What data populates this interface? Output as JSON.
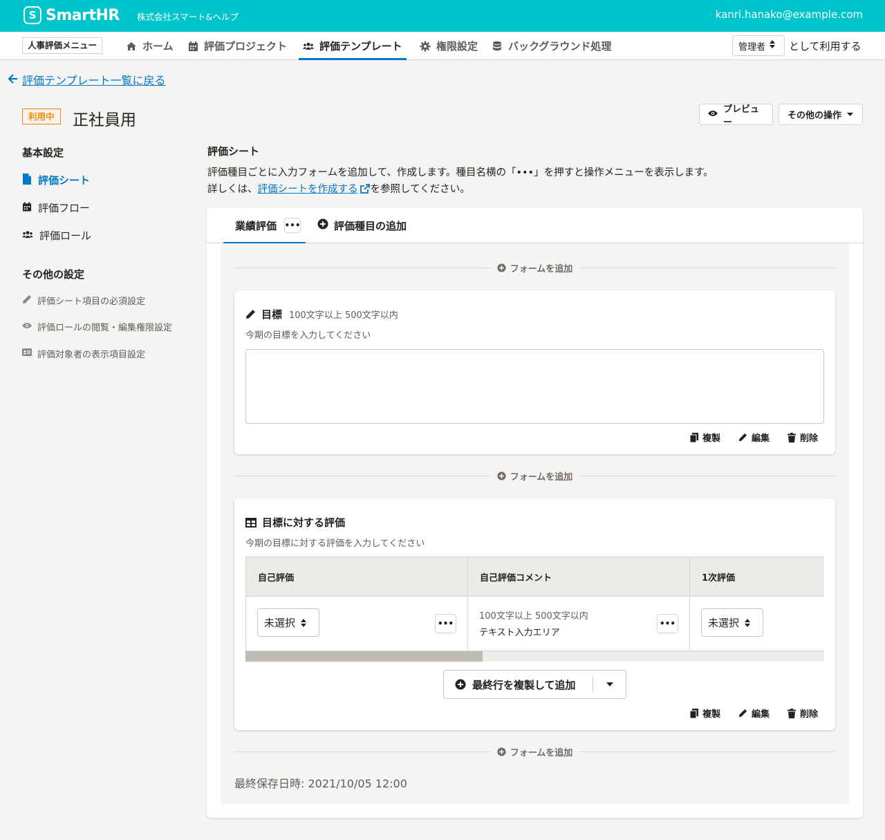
{
  "header": {
    "brand": "SmartHR",
    "tenant": "株式会社スマート&ヘルプ",
    "user_email": "kanri.hanako@example.com"
  },
  "nav": {
    "menu_label": "人事評価メニュー",
    "items": [
      {
        "label": "ホーム",
        "icon": "home-icon"
      },
      {
        "label": "評価プロジェクト",
        "icon": "calendar-icon"
      },
      {
        "label": "評価テンプレート",
        "icon": "users-icon",
        "active": true
      },
      {
        "label": "権限設定",
        "icon": "gear-icon"
      },
      {
        "label": "バックグラウンド処理",
        "icon": "database-icon"
      }
    ],
    "role_value": "管理者",
    "role_suffix": "として利用する"
  },
  "back_link": "評価テンプレート一覧に戻る",
  "template": {
    "status": "利用中",
    "title": "正社員用",
    "preview_label": "プレビュー",
    "other_actions_label": "その他の操作"
  },
  "sidebar": {
    "basic_heading": "基本設定",
    "basic_items": [
      {
        "label": "評価シート",
        "icon": "document-icon",
        "active": true
      },
      {
        "label": "評価フロー",
        "icon": "calendar-icon"
      },
      {
        "label": "評価ロール",
        "icon": "users-icon"
      }
    ],
    "other_heading": "その他の設定",
    "other_items": [
      {
        "label": "評価シート項目の必須設定",
        "icon": "pencil-icon"
      },
      {
        "label": "評価ロールの閲覧・編集権限設定",
        "icon": "eye-icon"
      },
      {
        "label": "評価対象者の表示項目設定",
        "icon": "id-card-icon"
      }
    ]
  },
  "sheet": {
    "heading": "評価シート",
    "description_line1": "評価種目ごとに入力フォームを追加して、作成します。種目名横の「•••」を押すと操作メニューを表示します。",
    "description_prefix": "詳しくは、",
    "description_link": "評価シートを作成する",
    "description_suffix": "を参照してください。",
    "tab_label": "業績評価",
    "tab_more": "•••",
    "add_category_label": "評価種目の追加",
    "add_form_label": "フォームを追加",
    "form1": {
      "title": "目標",
      "hint": "100文字以上  500文字以内",
      "description": "今期の目標を入力してください"
    },
    "form2": {
      "title": "目標に対する評価",
      "description": "今期の目標に対する評価を入力してください",
      "columns": [
        "自己評価",
        "自己評価コメント",
        "1次評価"
      ],
      "cell_select": "未選択",
      "cell_more": "•••",
      "comment_hint": "100文字以上  500文字以内",
      "comment_type": "テキスト入力エリア",
      "scroll_fraction": 0.41,
      "duplicate_add_label": "最終行を複製して追加"
    },
    "actions": {
      "duplicate": "複製",
      "edit": "編集",
      "delete": "削除"
    },
    "last_saved": "最終保存日時: 2021/10/05 12:00"
  },
  "colors": {
    "brand": "#00c4cc",
    "link": "#0077c7",
    "badge": "#ff8800"
  }
}
